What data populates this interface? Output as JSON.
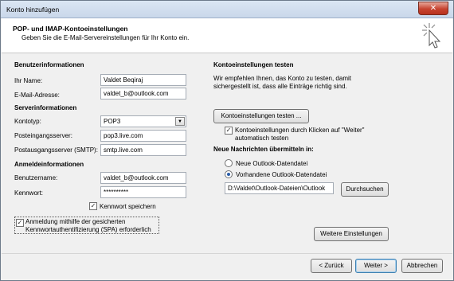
{
  "window": {
    "title": "Konto hinzufügen",
    "close_label": "✕"
  },
  "header": {
    "title": "POP- und IMAP-Kontoeinstellungen",
    "subtitle": "Geben Sie die E-Mail-Servereinstellungen für Ihr Konto ein."
  },
  "user_info": {
    "section": "Benutzerinformationen",
    "name_label": "Ihr Name:",
    "name_value": "Valdet Beqiraj",
    "email_label": "E-Mail-Adresse:",
    "email_value": "valdet_b@outlook.com"
  },
  "server_info": {
    "section": "Serverinformationen",
    "type_label": "Kontotyp:",
    "type_value": "POP3",
    "incoming_label": "Posteingangsserver:",
    "incoming_value": "pop3.live.com",
    "outgoing_label": "Postausgangsserver (SMTP):",
    "outgoing_value": "smtp.live.com"
  },
  "login_info": {
    "section": "Anmeldeinformationen",
    "username_label": "Benutzername:",
    "username_value": "valdet_b@outlook.com",
    "password_label": "Kennwort:",
    "password_value": "**********",
    "remember_label": "Kennwort speichern",
    "remember_checked": true,
    "spa_label_1": "Anmeldung mithilfe der gesicherten",
    "spa_label_2": "Kennwortauthentifizierung (SPA) erforderlich",
    "spa_checked": true
  },
  "test": {
    "section": "Kontoeinstellungen testen",
    "desc_1": "Wir empfehlen Ihnen, das Konto zu testen, damit",
    "desc_2": "sichergestellt ist, dass alle Einträge richtig sind.",
    "test_button": "Kontoeinstellungen testen ...",
    "auto_label_1": "Kontoeinstellungen durch Klicken auf \"Weiter\"",
    "auto_label_2": "automatisch testen",
    "auto_checked": true
  },
  "deliver": {
    "section": "Neue Nachrichten übermitteln in:",
    "option_new": "Neue Outlook-Datendatei",
    "option_existing": "Vorhandene Outlook-Datendatei",
    "selected": "existing",
    "path_value": "D:\\Valdet\\Outlook-Dateien\\Outlook",
    "browse_button": "Durchsuchen"
  },
  "more_settings_button": "Weitere Einstellungen",
  "footer": {
    "back": "< Zurück",
    "next": "Weiter >",
    "cancel": "Abbrechen"
  },
  "check_glyph": "✓",
  "dropdown_glyph": "▼"
}
